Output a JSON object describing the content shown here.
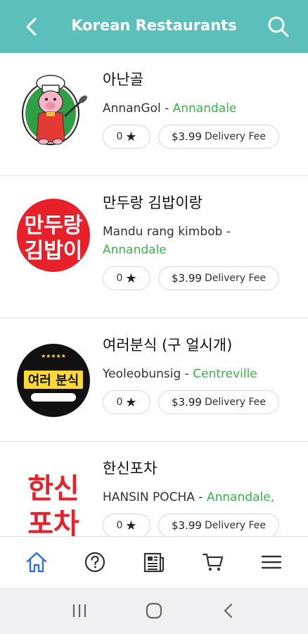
{
  "header": {
    "title": "Korean Restaurants",
    "back_icon": "back-arrow-icon",
    "search_icon": "search-icon",
    "bg_color": "#5bbfba"
  },
  "restaurants": [
    {
      "name_ko": "아난골",
      "name_en": "AnnanGol",
      "separator": " - ",
      "location": "Annandale",
      "rating": "0",
      "fee_amount": "$3.99",
      "fee_label": "Delivery Fee",
      "logo": "chef-pig-logo"
    },
    {
      "name_ko": "만두랑 김밥이랑",
      "name_en": "Mandu rang kimbob",
      "separator": " - ",
      "location": "Annandale",
      "rating": "0",
      "fee_amount": "$3.99",
      "fee_label": "Delivery Fee",
      "logo": "mandu-kimbap-logo",
      "logo_text_top": "만두랑",
      "logo_text_bottom": "김밥이"
    },
    {
      "name_ko": "여러분식 (구 얼시개)",
      "name_en": "Yeoleobunsig",
      "separator": " - ",
      "location": "Centreville",
      "rating": "0",
      "fee_amount": "$3.99",
      "fee_label": "Delivery Fee",
      "logo": "yeoleo-bunsik-logo",
      "logo_text": "여러 분식"
    },
    {
      "name_ko": "한신포차",
      "name_en": "HANSIN POCHA",
      "separator": " - ",
      "location": "Annandale,",
      "rating": "0",
      "fee_amount": "$3.99",
      "fee_label": "Delivery Fee",
      "logo": "hansin-pocha-logo",
      "logo_text_top": "한신",
      "logo_text_bottom": "포차"
    }
  ],
  "bottom_nav": {
    "items": [
      "home-icon",
      "help-icon",
      "news-icon",
      "cart-icon",
      "menu-icon"
    ],
    "active": "home-icon",
    "active_color": "#2f6fd8"
  },
  "system_nav": {
    "items": [
      "recent-apps-icon",
      "home-circle-icon",
      "back-chevron-icon"
    ]
  },
  "colors": {
    "accent_green": "#39b54a",
    "brand_teal": "#5bbfba"
  }
}
